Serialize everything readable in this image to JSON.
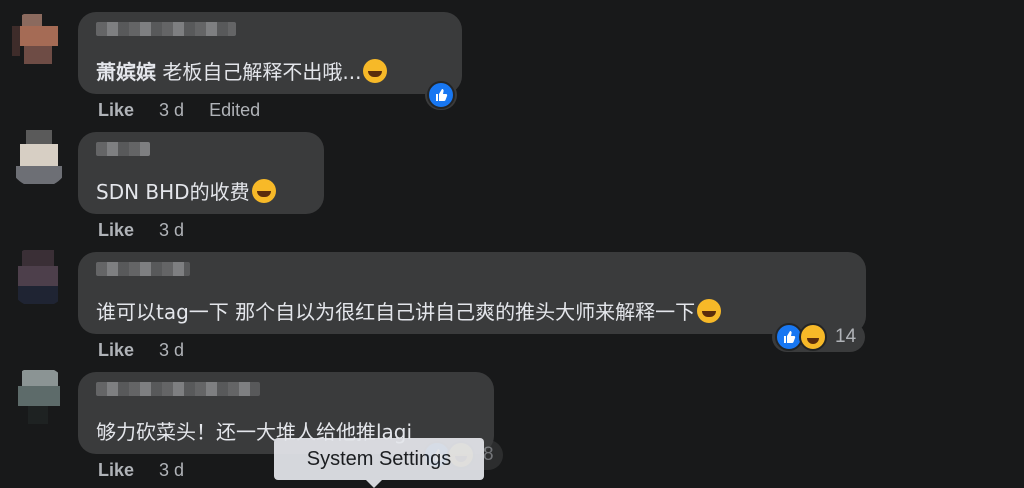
{
  "comments": [
    {
      "text_prefix": "萧嫔嫔",
      "text": " 老板自己解释不出哦...",
      "meta": {
        "like": "Like",
        "time": "3 d",
        "edited": "Edited"
      }
    },
    {
      "text": "SDN BHD的收费",
      "meta": {
        "like": "Like",
        "time": "3 d"
      }
    },
    {
      "text": "谁可以tag一下 那个自以为很红自己讲自己爽的推头大师来解释一下",
      "meta": {
        "like": "Like",
        "time": "3 d"
      },
      "reaction_count": "14"
    },
    {
      "text": "够力砍菜头！还一大堆人给他推lagi",
      "meta": {
        "like": "Like",
        "time": "3 d"
      },
      "reaction_count": "8"
    }
  ],
  "tooltip": "System Settings",
  "icons": {
    "like": "thumbs-up-icon",
    "haha": "laughing-emoji-icon",
    "emoji": "rofl-emoji-icon"
  },
  "colors": {
    "background": "#18191a",
    "bubble": "#3a3b3c",
    "like_blue": "#1877f2"
  }
}
